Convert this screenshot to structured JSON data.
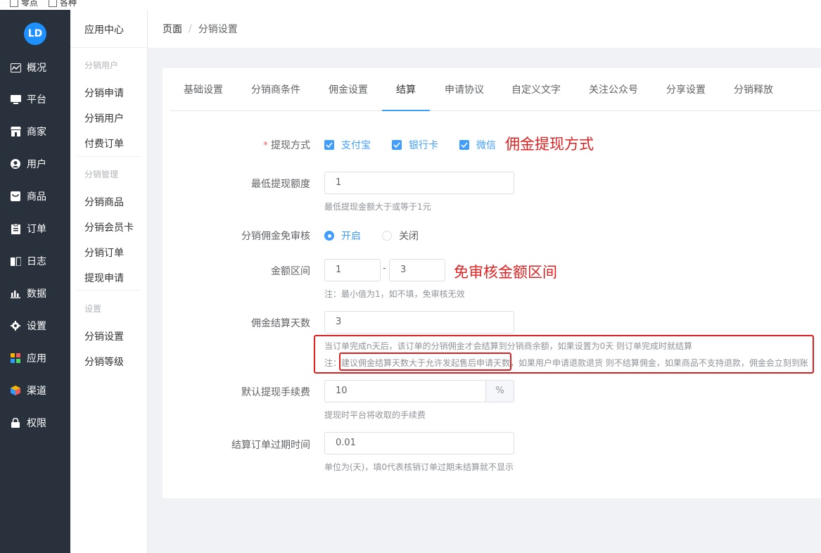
{
  "top_strip": {
    "chk1": "零点",
    "chk2": "各种"
  },
  "sidebar": {
    "logo": "LD",
    "items": [
      {
        "label": "概况",
        "icon": "chart-icon"
      },
      {
        "label": "平台",
        "icon": "monitor-icon"
      },
      {
        "label": "商家",
        "icon": "store-icon"
      },
      {
        "label": "用户",
        "icon": "user-icon"
      },
      {
        "label": "商品",
        "icon": "goods-icon"
      },
      {
        "label": "订单",
        "icon": "order-icon"
      },
      {
        "label": "日志",
        "icon": "log-icon"
      },
      {
        "label": "数据",
        "icon": "bar-chart-icon"
      },
      {
        "label": "设置",
        "icon": "gear-icon"
      },
      {
        "label": "应用",
        "icon": "apps-icon"
      },
      {
        "label": "渠道",
        "icon": "cube-icon"
      },
      {
        "label": "权限",
        "icon": "lock-icon"
      }
    ]
  },
  "subnav": {
    "title": "应用中心",
    "group1": "分销用户",
    "apply": "分销申请",
    "users": "分销用户",
    "paid_orders": "付费订单",
    "group2": "分销管理",
    "goods": "分销商品",
    "member_card": "分销会员卡",
    "orders": "分销订单",
    "withdraw": "提现申请",
    "group3": "设置",
    "settings": "分销设置",
    "levels": "分销等级"
  },
  "breadcrumb": {
    "root": "页面",
    "sep": "/",
    "current": "分销设置"
  },
  "tabs": [
    "基础设置",
    "分销商条件",
    "佣金设置",
    "结算",
    "申请协议",
    "自定义文字",
    "关注公众号",
    "分享设置",
    "分销释放"
  ],
  "form": {
    "withdraw_method": {
      "label": "提现方式",
      "required": "*",
      "options": [
        "支付宝",
        "银行卡",
        "微信"
      ],
      "annotation": "佣金提现方式"
    },
    "min_withdraw": {
      "label": "最低提现额度",
      "value": "1",
      "hint": "最低提现金额大于或等于1元"
    },
    "audit_free": {
      "label": "分销佣金免审核",
      "on": "开启",
      "off": "关闭"
    },
    "amount_range": {
      "label": "金额区间",
      "min": "1",
      "dash": "-",
      "max": "3",
      "hint": "注：最小值为1，如不填，免审核无效",
      "annotation": "免审核金额区间"
    },
    "settle_days": {
      "label": "佣金结算天数",
      "value": "3",
      "hint1": "当订单完成n天后，该订单的分销佣金才会结算到分销商余额，如果设置为0天 则订单完成时就结算",
      "hint2_prefix": "注：",
      "hint2_highlight": "建议佣金结算天数大于允许发起售后申请天数",
      "hint2_rest": "，如果用户申请退款退货 则不结算佣金，如果商品不支持退款，佣金会立刻到账"
    },
    "fee": {
      "label": "默认提现手续费",
      "value": "10",
      "unit": "%",
      "hint": "提现时平台将收取的手续费"
    },
    "expire": {
      "label": "结算订单过期时间",
      "value": "0.01",
      "hint": "单位为(天)，填0代表核销订单过期未结算就不显示"
    }
  },
  "colors": {
    "sidebar_bg": "#28313c",
    "accent": "#409eff",
    "annotation_red": "#e02020"
  }
}
